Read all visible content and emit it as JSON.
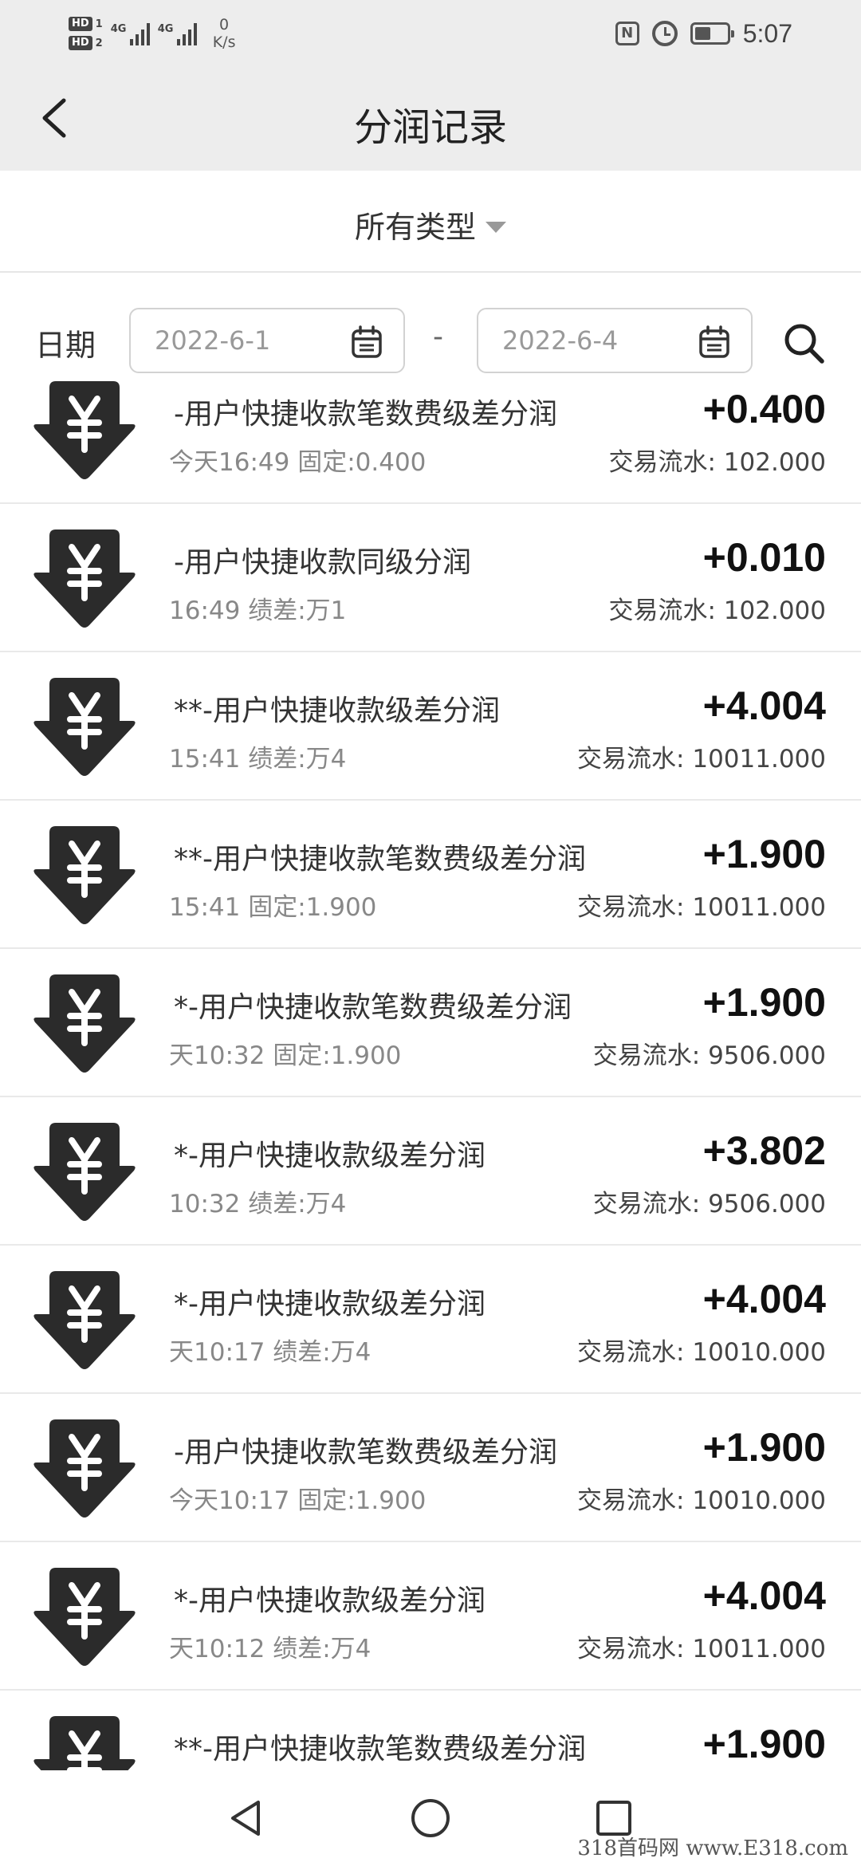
{
  "status_bar": {
    "sim1": "HD",
    "sim1_slot": "1",
    "sim2": "HD",
    "sim2_slot": "2",
    "net1": "4G",
    "net2": "4G",
    "speed_value": "0",
    "speed_unit": "K/s",
    "battery_level": 0.5,
    "time": "5:07"
  },
  "header": {
    "title": "分润记录"
  },
  "filter": {
    "type_label": "所有类型"
  },
  "date_filter": {
    "label": "日期",
    "from": "2022-6-1",
    "separator": "-",
    "to": "2022-6-4"
  },
  "records": [
    {
      "title": "-用户快捷收款笔数费级差分润",
      "time": "今天16:49",
      "detail": "固定:0.400",
      "amount": "+0.400",
      "flow_label": "交易流水:",
      "flow": "102.000"
    },
    {
      "title": "-用户快捷收款同级分润",
      "time": "16:49",
      "detail": "绩差:万1",
      "amount": "+0.010",
      "flow_label": "交易流水:",
      "flow": "102.000"
    },
    {
      "title": "**-用户快捷收款级差分润",
      "time": "15:41",
      "detail": "绩差:万4",
      "amount": "+4.004",
      "flow_label": "交易流水:",
      "flow": "10011.000"
    },
    {
      "title": "**-用户快捷收款笔数费级差分润",
      "time": "15:41",
      "detail": "固定:1.900",
      "amount": "+1.900",
      "flow_label": "交易流水:",
      "flow": "10011.000"
    },
    {
      "title": "*-用户快捷收款笔数费级差分润",
      "time": "天10:32",
      "detail": "固定:1.900",
      "amount": "+1.900",
      "flow_label": "交易流水:",
      "flow": "9506.000"
    },
    {
      "title": "*-用户快捷收款级差分润",
      "time": "10:32",
      "detail": "绩差:万4",
      "amount": "+3.802",
      "flow_label": "交易流水:",
      "flow": "9506.000"
    },
    {
      "title": "*-用户快捷收款级差分润",
      "time": "天10:17",
      "detail": "绩差:万4",
      "amount": "+4.004",
      "flow_label": "交易流水:",
      "flow": "10010.000"
    },
    {
      "title": "-用户快捷收款笔数费级差分润",
      "time": "今天10:17",
      "detail": "固定:1.900",
      "amount": "+1.900",
      "flow_label": "交易流水:",
      "flow": "10010.000"
    },
    {
      "title": "*-用户快捷收款级差分润",
      "time": "天10:12",
      "detail": "绩差:万4",
      "amount": "+4.004",
      "flow_label": "交易流水:",
      "flow": "10011.000"
    },
    {
      "title": "**-用户快捷收款笔数费级差分润",
      "time": "",
      "detail": "",
      "amount": "+1.900",
      "flow_label": "",
      "flow": ""
    }
  ],
  "icons": {
    "back": "back-chevron-icon",
    "caret": "caret-down-icon",
    "calendar": "calendar-icon",
    "search": "search-icon",
    "record": "yuan-down-arrow-icon",
    "nav_back": "triangle-back-icon",
    "nav_home": "circle-home-icon",
    "nav_recent": "square-recent-icon"
  },
  "watermark": "318首码网 www.E318.com",
  "colors": {
    "header_bg": "#ededed",
    "icon": "#2b2b2b",
    "amount": "#111111"
  }
}
